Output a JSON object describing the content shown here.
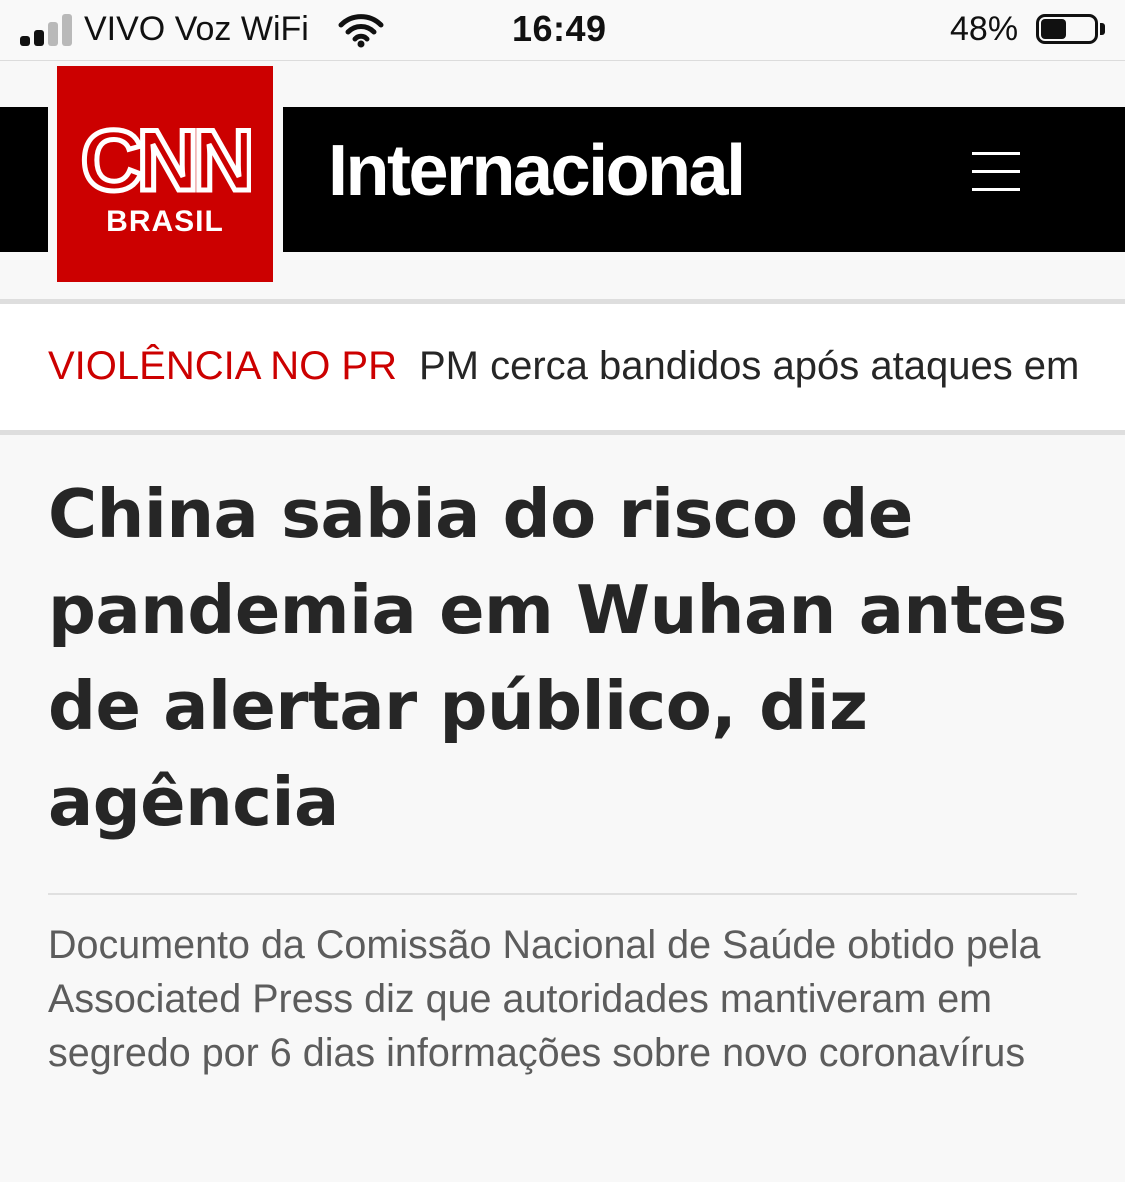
{
  "status_bar": {
    "carrier": "VIVO Voz WiFi",
    "time": "16:49",
    "battery_percent": "48%",
    "battery_level": 0.48,
    "signal_bars_filled": 2,
    "signal_bars_total": 4
  },
  "header": {
    "logo_text": "CNN",
    "logo_subtitle": "BRASIL",
    "section_title": "Internacional",
    "menu_icon": "hamburger-menu-icon"
  },
  "ticker": {
    "label": "VIOLÊNCIA NO PR",
    "text": "PM cerca bandidos após ataques em"
  },
  "article": {
    "headline": "China sabia do risco de pandemia em Wuhan antes de alertar público, diz agência",
    "summary": "Documento da Comissão Nacional de Saúde obtido pela Associated Press diz que autoridades mantiveram em segredo por 6 dias informações sobre novo coronavírus"
  },
  "colors": {
    "brand_red": "#cc0000",
    "header_black": "#000000",
    "headline_text": "#262626",
    "summary_text": "#5c5c5c"
  }
}
